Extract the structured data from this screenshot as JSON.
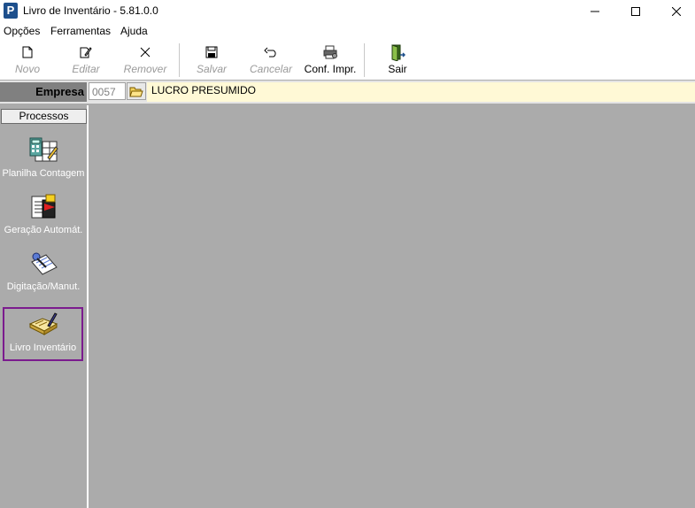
{
  "window": {
    "title": "Livro de Inventário - 5.81.0.0",
    "app_icon_letter": "P"
  },
  "menu": [
    "Opções",
    "Ferramentas",
    "Ajuda"
  ],
  "toolbar": {
    "buttons": [
      {
        "label": "Novo",
        "enabled": false
      },
      {
        "label": "Editar",
        "enabled": false
      },
      {
        "label": "Remover",
        "enabled": false
      },
      {
        "label": "Salvar",
        "enabled": false
      },
      {
        "label": "Cancelar",
        "enabled": false
      },
      {
        "label": "Conf. Impr.",
        "enabled": true
      },
      {
        "label": "Sair",
        "enabled": true
      }
    ]
  },
  "empresa": {
    "label": "Empresa",
    "code": "0057",
    "name": "LUCRO PRESUMIDO"
  },
  "sidebar": {
    "header": "Processos",
    "items": [
      {
        "label": "Planilha Contagem",
        "icon": "spreadsheet-calculator-icon"
      },
      {
        "label": "Geração Automát.",
        "icon": "auto-generation-icon"
      },
      {
        "label": "Digitação/Manut.",
        "icon": "typing-maintenance-icon"
      },
      {
        "label": "Livro Inventário",
        "icon": "inventory-book-icon",
        "selected": true
      }
    ]
  },
  "colors": {
    "sidebar_bg": "#ababab",
    "empresa_name_bg": "#fff9d6",
    "selected_outline": "#7b1b8e"
  }
}
